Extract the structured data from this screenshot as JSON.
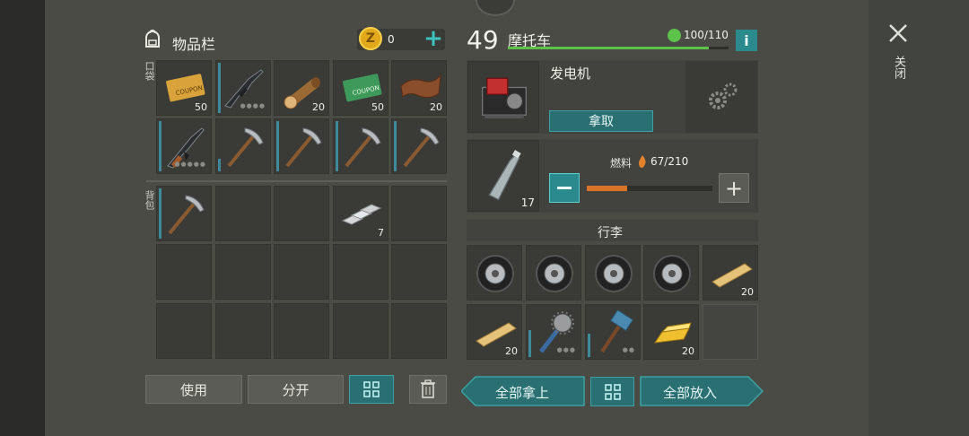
{
  "inventory": {
    "title": "物品栏",
    "coins": "0",
    "pocket_label": "口袋",
    "backpack_label": "背包",
    "pocket_slots": [
      {
        "name": "coupon-gold",
        "qty": "50"
      },
      {
        "name": "rifle",
        "qty": ""
      },
      {
        "name": "log",
        "qty": "20"
      },
      {
        "name": "coupon-green",
        "qty": "50"
      },
      {
        "name": "leather",
        "qty": "20"
      },
      {
        "name": "ak-rifle",
        "qty": ""
      },
      {
        "name": "pickaxe",
        "qty": ""
      },
      {
        "name": "pickaxe",
        "qty": ""
      },
      {
        "name": "pickaxe",
        "qty": ""
      },
      {
        "name": "pickaxe",
        "qty": ""
      }
    ],
    "backpack_slots": [
      {
        "name": "pickaxe",
        "qty": ""
      },
      {
        "name": "empty",
        "qty": ""
      },
      {
        "name": "empty",
        "qty": ""
      },
      {
        "name": "iron-bars",
        "qty": "7"
      },
      {
        "name": "empty",
        "qty": ""
      }
    ],
    "use_label": "使用",
    "split_label": "分开"
  },
  "vehicle": {
    "level": "49",
    "name": "摩托车",
    "durability_text": "100/110",
    "durability_fraction": 0.909,
    "generator_name": "发电机",
    "take_label": "拿取",
    "fuel_label": "燃料",
    "fuel_value": "67/210",
    "fuel_fraction": 0.319,
    "bottle_qty": "17",
    "luggage_label": "行李",
    "luggage_slots": [
      {
        "name": "tire",
        "qty": ""
      },
      {
        "name": "tire",
        "qty": ""
      },
      {
        "name": "tire",
        "qty": ""
      },
      {
        "name": "tire",
        "qty": ""
      },
      {
        "name": "plank",
        "qty": "20"
      },
      {
        "name": "plank",
        "qty": "20"
      },
      {
        "name": "spiked-mace",
        "qty": ""
      },
      {
        "name": "hammer",
        "qty": ""
      },
      {
        "name": "gold-bar",
        "qty": "20"
      },
      {
        "name": "empty",
        "qty": ""
      }
    ],
    "take_all_label": "全部拿上",
    "put_all_label": "全部放入"
  },
  "close_label": "关闭",
  "colors": {
    "accent": "#3da1a4",
    "health": "#5cc24a",
    "fuel": "#d8742a"
  }
}
